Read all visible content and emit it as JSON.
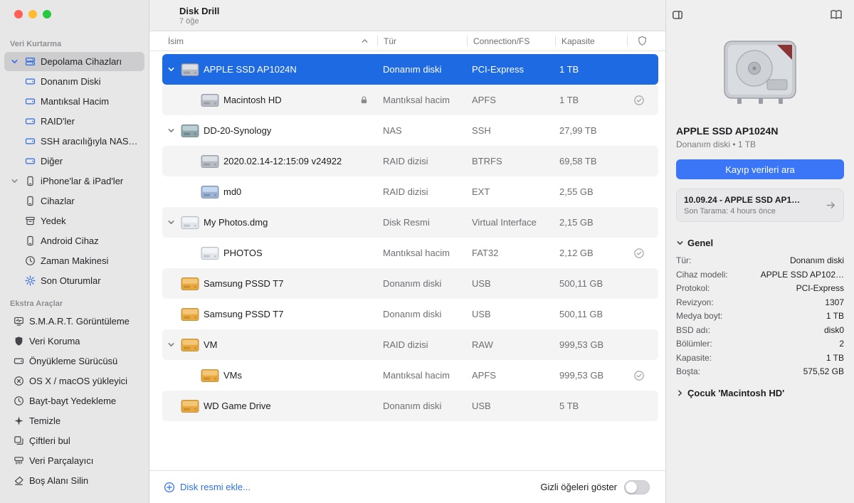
{
  "window": {
    "app_title": "Disk Drill",
    "item_count": "7 öğe"
  },
  "colors": {
    "selection_blue": "#1e6ae3",
    "button_blue": "#3b76f6",
    "link_blue": "#2e6fe5",
    "sidebar_accent_blue": "#2e6be5",
    "external_drive_orange": "#e9a83f"
  },
  "sidebar": {
    "sections": [
      {
        "title": "Veri Kurtarma",
        "items": [
          {
            "id": "depolama-cihazlari",
            "label": "Depolama Cihazları",
            "icon": "drive-stack",
            "chevron": "down",
            "tint": "blue",
            "selected": true,
            "level": 0,
            "slot": true
          },
          {
            "id": "donanim-diski",
            "label": "Donanım Diski",
            "icon": "drive",
            "tint": "blue",
            "level": 1,
            "slot": false
          },
          {
            "id": "mantiksal-hacim",
            "label": "Mantıksal Hacim",
            "icon": "drive",
            "tint": "blue",
            "level": 1,
            "slot": false
          },
          {
            "id": "raidler",
            "label": "RAID'ler",
            "icon": "drive",
            "tint": "blue",
            "level": 1,
            "slot": false
          },
          {
            "id": "ssh-araciligiyla-nas",
            "label": "SSH aracılığıyla NAS…",
            "icon": "drive",
            "tint": "blue",
            "level": 1,
            "slot": false
          },
          {
            "id": "diger",
            "label": "Diğer",
            "icon": "drive",
            "tint": "blue",
            "level": 1,
            "slot": false
          },
          {
            "id": "iphonelar-ipadler",
            "label": "iPhone'lar & iPad'ler",
            "icon": "phone",
            "chevron": "down",
            "level": 0,
            "slot": true
          },
          {
            "id": "cihazlar",
            "label": "Cihazlar",
            "icon": "phone",
            "level": 1,
            "slot": false
          },
          {
            "id": "yedek",
            "label": "Yedek",
            "icon": "archive",
            "level": 1,
            "slot": false
          },
          {
            "id": "android-cihaz",
            "label": "Android Cihaz",
            "icon": "phone",
            "level": 0,
            "slot": true
          },
          {
            "id": "zaman-makinesi",
            "label": "Zaman Makinesi",
            "icon": "clock",
            "level": 0,
            "slot": true
          },
          {
            "id": "son-oturumlar",
            "label": "Son Oturumlar",
            "icon": "gear",
            "tint": "blue",
            "level": 0,
            "slot": true
          }
        ]
      },
      {
        "title": "Ekstra Araçlar",
        "items": [
          {
            "id": "smart-goruntuleme",
            "label": "S.M.A.R.T. Görüntüleme",
            "icon": "monitor",
            "level": 0,
            "slot": false
          },
          {
            "id": "veri-koruma",
            "label": "Veri Koruma",
            "icon": "shield",
            "level": 0,
            "slot": false
          },
          {
            "id": "onyukleme-surucusu",
            "label": "Önyükleme Sürücüsü",
            "icon": "drive",
            "level": 0,
            "slot": false
          },
          {
            "id": "osx-macos-yukleyici",
            "label": "OS X / macOS yükleyici",
            "icon": "circle-x",
            "level": 0,
            "slot": false
          },
          {
            "id": "bayt-bayt-yedekleme",
            "label": "Bayt-bayt Yedekleme",
            "icon": "clock",
            "level": 0,
            "slot": false
          },
          {
            "id": "temizle",
            "label": "Temizle",
            "icon": "sparkle",
            "level": 0,
            "slot": false
          },
          {
            "id": "ciftleri-bul",
            "label": "Çiftleri bul",
            "icon": "duplicate",
            "level": 0,
            "slot": false
          },
          {
            "id": "veri-parcalayici",
            "label": "Veri Parçalayıcı",
            "icon": "shredder",
            "level": 0,
            "slot": false
          },
          {
            "id": "bos-alani-silin",
            "label": "Boş Alanı Silin",
            "icon": "eraser",
            "level": 0,
            "slot": false
          }
        ]
      }
    ]
  },
  "table": {
    "columns": [
      "İsim",
      "Tür",
      "Connection/FS",
      "Kapasite"
    ],
    "rows": [
      {
        "name": "APPLE SSD AP1024N",
        "type": "Donanım diski",
        "fs": "PCI-Express",
        "capacity": "1 TB",
        "icon": "internal",
        "expand": true,
        "selected": true
      },
      {
        "name": "Macintosh HD",
        "type": "Mantıksal hacim",
        "fs": "APFS",
        "capacity": "1 TB",
        "icon": "internal",
        "child": true,
        "lock": true,
        "shield": true
      },
      {
        "name": "DD-20-Synology",
        "type": "NAS",
        "fs": "SSH",
        "capacity": "27,99 TB",
        "icon": "nas",
        "expand": true
      },
      {
        "name": "2020.02.14-12:15:09 v24922",
        "type": "RAID dizisi",
        "fs": "BTRFS",
        "capacity": "69,58 TB",
        "icon": "internal",
        "child": true
      },
      {
        "name": "md0",
        "type": "RAID dizisi",
        "fs": "EXT",
        "capacity": "2,55 GB",
        "icon": "raid",
        "child": true
      },
      {
        "name": "My Photos.dmg",
        "type": "Disk Resmi",
        "fs": "Virtual Interface",
        "capacity": "2,15 GB",
        "icon": "image",
        "expand": true
      },
      {
        "name": "PHOTOS",
        "type": "Mantıksal hacim",
        "fs": "FAT32",
        "capacity": "2,12 GB",
        "icon": "image",
        "child": true,
        "shield": true
      },
      {
        "name": "Samsung PSSD T7",
        "type": "Donanım diski",
        "fs": "USB",
        "capacity": "500,11 GB",
        "icon": "external"
      },
      {
        "name": "Samsung PSSD T7",
        "type": "Donanım diski",
        "fs": "USB",
        "capacity": "500,11 GB",
        "icon": "external"
      },
      {
        "name": "VM",
        "type": "RAID dizisi",
        "fs": "RAW",
        "capacity": "999,53 GB",
        "icon": "external",
        "expand": true
      },
      {
        "name": "VMs",
        "type": "Mantıksal hacim",
        "fs": "APFS",
        "capacity": "999,53 GB",
        "icon": "external",
        "child": true,
        "shield": true
      },
      {
        "name": "WD Game Drive",
        "type": "Donanım diski",
        "fs": "USB",
        "capacity": "5 TB",
        "icon": "external"
      }
    ]
  },
  "footer": {
    "add_disk_image": "Disk resmi ekle...",
    "show_hidden_label": "Gizli öğeleri göster"
  },
  "details": {
    "title": "APPLE SSD AP1024N",
    "subtitle": "Donanım diski • 1 TB",
    "scan_button": "Kayıp verileri ara",
    "last_session": {
      "title": "10.09.24 - APPLE SSD AP1…",
      "subtitle": "Son Tarama: 4 hours önce"
    },
    "general_title": "Genel",
    "general_rows": [
      {
        "label": "Tür:",
        "value": "Donanım diski"
      },
      {
        "label": "Cihaz modeli:",
        "value": "APPLE SSD AP102…"
      },
      {
        "label": "Protokol:",
        "value": "PCI-Express"
      },
      {
        "label": "Revizyon:",
        "value": "1307"
      },
      {
        "label": "Medya boyt:",
        "value": "1 TB"
      },
      {
        "label": "BSD adı:",
        "value": "disk0"
      },
      {
        "label": "Bölümler:",
        "value": "2"
      },
      {
        "label": "Kapasite:",
        "value": "1 TB"
      },
      {
        "label": "Boşta:",
        "value": "575,52 GB"
      }
    ],
    "child_section": "Çocuk 'Macintosh HD'"
  }
}
